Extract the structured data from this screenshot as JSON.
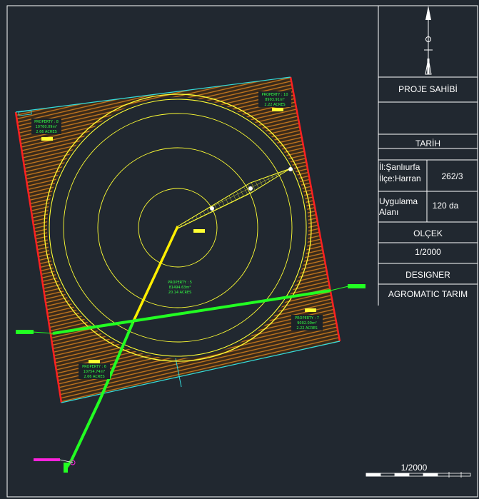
{
  "title_block": {
    "owner_label": "PROJE SAHİBİ",
    "date_label": "TARİH",
    "province": "İl:Şanlıurfa",
    "district": "İlçe:Harran",
    "parcel": "262/3",
    "area_label_line1": "Uygulama",
    "area_label_line2": "Alanı",
    "area_value": "120 da",
    "scale_label": "OLÇEK",
    "scale_value": "1/2000",
    "designer_label": "DESIGNER",
    "designer_value": "AGROMATIC TARIM"
  },
  "scale_bar": {
    "label": "1/2000"
  },
  "properties": [
    {
      "name": "PROPERTY : 8",
      "area": "10760.09m²",
      "acres": "2.66 ACRES"
    },
    {
      "name": "PROPERTY : 10",
      "area": "8993.91m²",
      "acres": "2.22 ACRES"
    },
    {
      "name": "PROPERTY : 5",
      "area": "81494.63m²",
      "acres": "20.14 ACRES"
    },
    {
      "name": "PROPERTY : 7",
      "area": "9002.09m²",
      "acres": "2.22 ACRES"
    },
    {
      "name": "PROPERTY : 6",
      "area": "10754.74m²",
      "acres": "2.66 ACRES"
    }
  ],
  "colors": {
    "background": "#212830",
    "hatch": "#c8791e",
    "boundary_red": "#ff2020",
    "boundary_cyan": "#33dddd",
    "circle_yellow": "#ffff33",
    "pipe_green": "#22ff22",
    "pivot_yellow": "#ffee00",
    "magenta": "#ff22dd"
  }
}
